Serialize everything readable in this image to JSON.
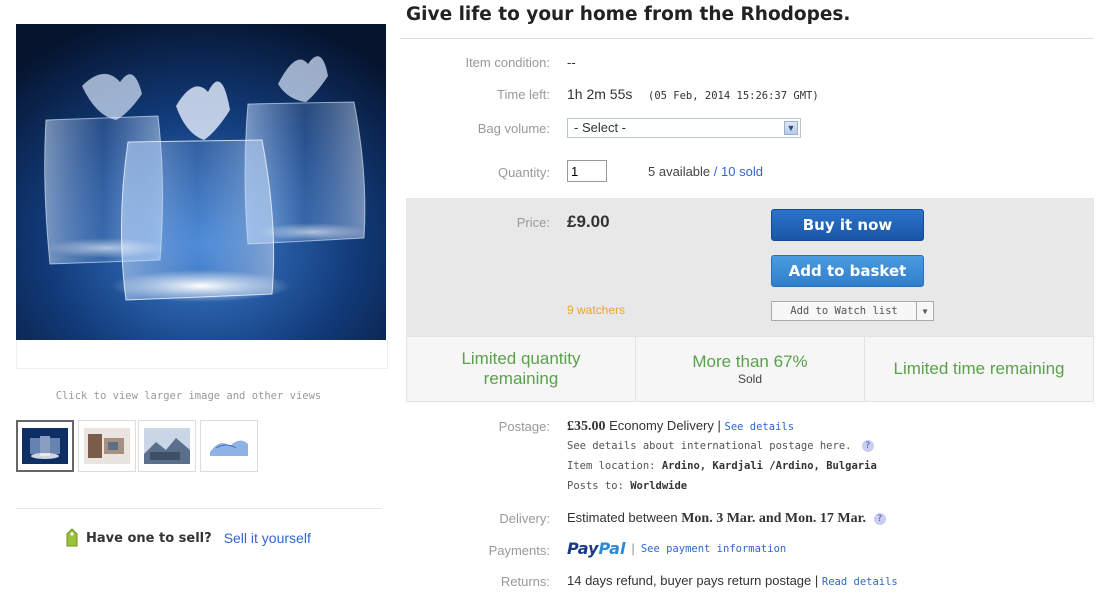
{
  "listing": {
    "title": "Give life to your home from the Rhodopes."
  },
  "gallery": {
    "hint": "Click to view larger image and other views",
    "thumb_count": 4,
    "selected_index": 0
  },
  "sell": {
    "question": "Have one to sell?",
    "link": "Sell it yourself"
  },
  "details": {
    "condition_label": "Item condition:",
    "condition_value": "--",
    "time_left_label": "Time left:",
    "time_left_value": "1h 2m 55s",
    "time_left_end": "(05 Feb, 2014  15:26:37 GMT)",
    "bag_volume_label": "Bag volume:",
    "bag_volume_selected": "- Select -",
    "quantity_label": "Quantity:",
    "quantity_value": "1",
    "available_text": "5 available",
    "sold_separator": "/",
    "sold_link": "10 sold"
  },
  "price_panel": {
    "price_label": "Price:",
    "price_value": "£9.00",
    "buy_now": "Buy it now",
    "add_to_basket": "Add to basket",
    "watchers": "9 watchers",
    "watch_list": "Add to Watch list"
  },
  "promos": [
    {
      "line1": "Limited quantity",
      "line2": "remaining",
      "sub": ""
    },
    {
      "line1": "More than 67%",
      "line2": "",
      "sub": "Sold"
    },
    {
      "line1": "Limited time remaining",
      "line2": "",
      "sub": ""
    }
  ],
  "postage": {
    "label": "Postage:",
    "price": "£35.00",
    "method": "Economy Delivery |",
    "see_details": "See details",
    "intl_note": "See details about international postage here.",
    "location_label": "Item location:",
    "location_value": "Ardino, Kardjali /Ardino, Bulgaria",
    "posts_to_label": "Posts to:",
    "posts_to_value": "Worldwide"
  },
  "delivery": {
    "label": "Delivery:",
    "prefix": "Estimated between",
    "range": "Mon. 3 Mar. and Mon. 17 Mar."
  },
  "payments": {
    "label": "Payments:",
    "paypal_pay": "Pay",
    "paypal_pal": "Pal",
    "link": "See payment information"
  },
  "returns": {
    "label": "Returns:",
    "text": "14 days refund, buyer pays return postage |",
    "link": "Read details"
  },
  "colors": {
    "buy_button": "#1a56a6",
    "basket_button": "#2f7fcc",
    "promo_green": "#5aa14b",
    "watchers_orange": "#e8a23a",
    "link_blue": "#3366cc",
    "price_panel_bg": "#e8e8e8",
    "paypal_dark": "#1b3a86",
    "paypal_light": "#2a8ad9"
  }
}
